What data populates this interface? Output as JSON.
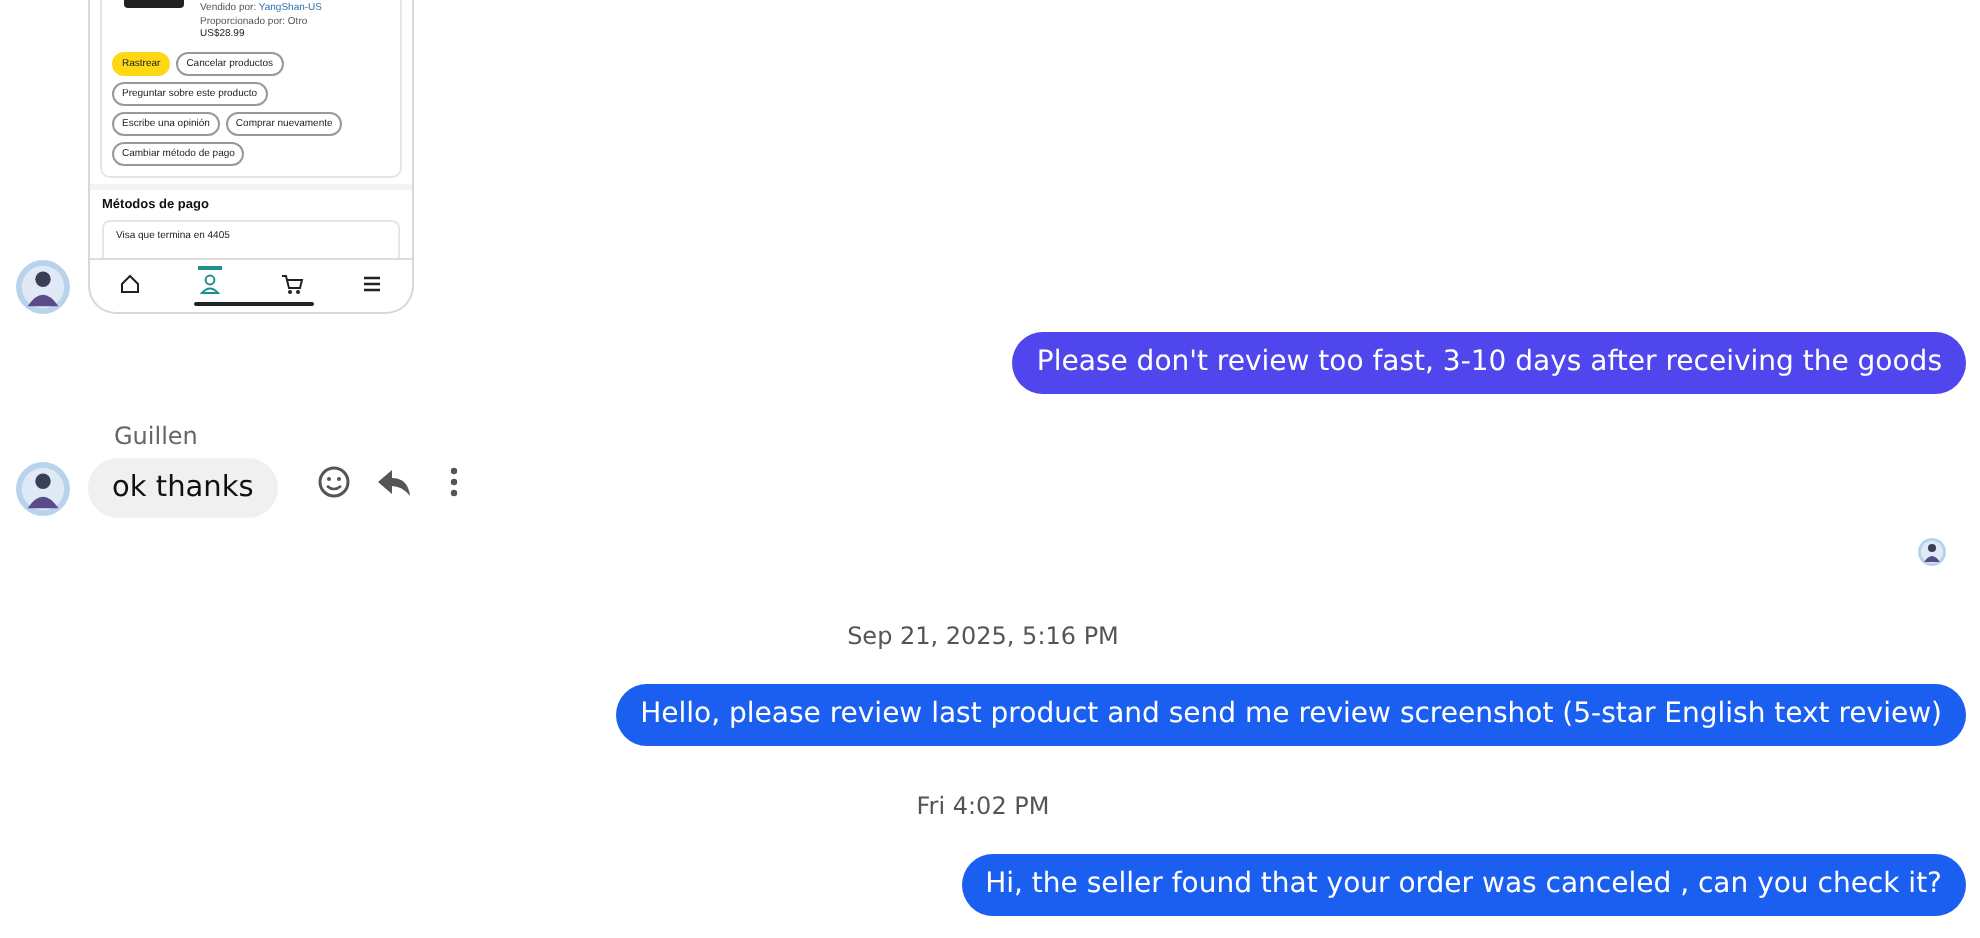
{
  "messages": [
    {
      "kind": "screenshot",
      "sold_by_label": "Vendido por:",
      "sold_by": "YangShan-US",
      "provided_by": "Proporcionado por: Otro",
      "price": "US$28.99",
      "actions": [
        {
          "label": "Rastrear",
          "kind": "primary"
        },
        {
          "label": "Cancelar productos",
          "kind": "secondary"
        },
        {
          "label": "Preguntar sobre este producto",
          "kind": "secondary"
        },
        {
          "label": "Escribe una opinión",
          "kind": "secondary"
        },
        {
          "label": "Comprar nuevamente",
          "kind": "secondary"
        },
        {
          "label": "Cambiar método de pago",
          "kind": "secondary"
        }
      ],
      "payment_heading": "Métodos de pago",
      "payment_method": "Visa  que termina en 4405",
      "nav": [
        {
          "kind": "home",
          "selected": false
        },
        {
          "kind": "account",
          "selected": true
        },
        {
          "kind": "cart",
          "selected": false
        },
        {
          "kind": "menu",
          "selected": false
        }
      ]
    },
    {
      "kind": "outgoing",
      "text": "Please don't review too fast, 3-10 days after receiving the goods",
      "color": "#4f46ed"
    },
    {
      "kind": "incoming",
      "sender": "Guillen",
      "text": "ok thanks"
    },
    {
      "kind": "seen"
    },
    {
      "kind": "timestamp",
      "text": "Sep 21, 2025, 5:16 PM"
    },
    {
      "kind": "outgoing",
      "text": "Hello, please review last product and send me review screenshot (5-star English text review)",
      "color": "#1a5ff0"
    },
    {
      "kind": "timestamp",
      "text": "Fri 4:02 PM"
    },
    {
      "kind": "outgoing",
      "text": "Hi, the seller found that your order was canceled , can you check it?",
      "color": "#1a5ff0"
    }
  ]
}
